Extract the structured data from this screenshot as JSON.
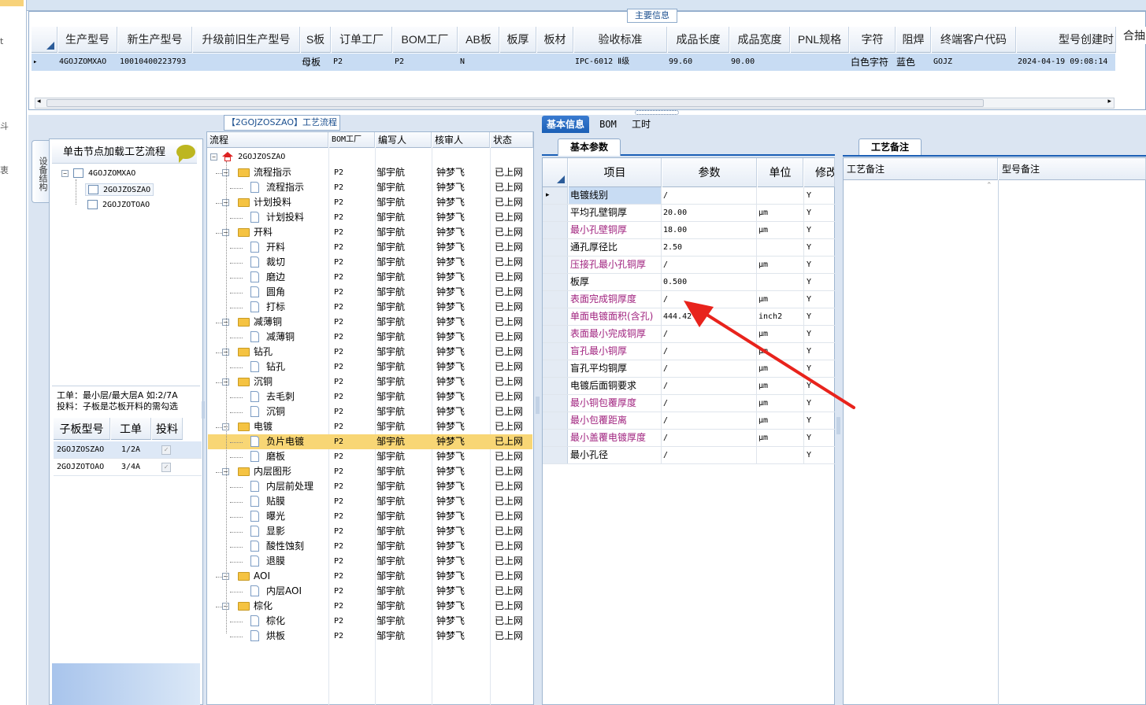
{
  "left_strip": {
    "glyphs": [
      "t",
      "斗",
      "衷"
    ]
  },
  "main_info": {
    "legend": "主要信息",
    "columns": [
      "生产型号",
      "新生产型号",
      "升级前旧生产型号",
      "S板",
      "订单工厂",
      "BOM工厂",
      "AB板",
      "板厚",
      "板材",
      "验收标准",
      "成品长度",
      "成品宽度",
      "PNL规格",
      "字符",
      "阻焊",
      "终端客户代码",
      "型号创建时",
      "合抽"
    ],
    "row": {
      "marker": "▸",
      "model": "4GOJZOMXAO",
      "new_model": "10010400223793",
      "old_model": "",
      "s_board": "母板",
      "order_factory": "P2",
      "bom_factory": "P2",
      "ab_board": "N",
      "thickness": "",
      "material": "",
      "standard": "IPC-6012 Ⅱ级",
      "length": "99.60",
      "width": "90.00",
      "pnl": "",
      "char": "白色字符",
      "mask": "蓝色",
      "customer": "GOJZ",
      "created": "2024-04-19 09:08:14",
      "merge": ""
    }
  },
  "left_panel": {
    "side_tab": "设备结构",
    "title": "单击节点加载工艺流程",
    "tree": [
      "4GOJZOMXAO",
      "2GOJZOSZAO",
      "2GOJZOTOAO"
    ],
    "note_line1": "工单：最小层/最大层A 如:2/7A",
    "note_line2": "投料：子板是芯板开料的需勾选",
    "sub_columns": [
      "子板型号",
      "工单",
      "投料"
    ],
    "sub_rows": [
      {
        "model": "2GOJZOSZAO",
        "order": "1/2A"
      },
      {
        "model": "2GOJZOTOAO",
        "order": "3/4A"
      }
    ]
  },
  "process": {
    "title": "【2GOJZOSZAO】工艺流程",
    "columns": [
      "流程",
      "BOM工厂",
      "编写人",
      "核审人",
      "状态"
    ],
    "root": "2GOJZOSZAO",
    "rows": [
      {
        "name": "流程指示",
        "type": "folder",
        "f": "P2",
        "w": "邹宇航",
        "r": "钟梦飞",
        "s": "已上网"
      },
      {
        "name": "流程指示",
        "type": "doc",
        "f": "P2",
        "w": "邹宇航",
        "r": "钟梦飞",
        "s": "已上网"
      },
      {
        "name": "计划投料",
        "type": "folder",
        "f": "P2",
        "w": "邹宇航",
        "r": "钟梦飞",
        "s": "已上网"
      },
      {
        "name": "计划投料",
        "type": "doc",
        "f": "P2",
        "w": "邹宇航",
        "r": "钟梦飞",
        "s": "已上网"
      },
      {
        "name": "开料",
        "type": "folder",
        "f": "P2",
        "w": "邹宇航",
        "r": "钟梦飞",
        "s": "已上网"
      },
      {
        "name": "开料",
        "type": "doc",
        "f": "P2",
        "w": "邹宇航",
        "r": "钟梦飞",
        "s": "已上网"
      },
      {
        "name": "裁切",
        "type": "doc",
        "f": "P2",
        "w": "邹宇航",
        "r": "钟梦飞",
        "s": "已上网"
      },
      {
        "name": "磨边",
        "type": "doc",
        "f": "P2",
        "w": "邹宇航",
        "r": "钟梦飞",
        "s": "已上网"
      },
      {
        "name": "圆角",
        "type": "doc",
        "f": "P2",
        "w": "邹宇航",
        "r": "钟梦飞",
        "s": "已上网"
      },
      {
        "name": "打标",
        "type": "doc",
        "f": "P2",
        "w": "邹宇航",
        "r": "钟梦飞",
        "s": "已上网"
      },
      {
        "name": "减薄铜",
        "type": "folder",
        "f": "P2",
        "w": "邹宇航",
        "r": "钟梦飞",
        "s": "已上网"
      },
      {
        "name": "减薄铜",
        "type": "doc",
        "f": "P2",
        "w": "邹宇航",
        "r": "钟梦飞",
        "s": "已上网"
      },
      {
        "name": "钻孔",
        "type": "folder",
        "f": "P2",
        "w": "邹宇航",
        "r": "钟梦飞",
        "s": "已上网"
      },
      {
        "name": "钻孔",
        "type": "doc",
        "f": "P2",
        "w": "邹宇航",
        "r": "钟梦飞",
        "s": "已上网"
      },
      {
        "name": "沉铜",
        "type": "folder",
        "f": "P2",
        "w": "邹宇航",
        "r": "钟梦飞",
        "s": "已上网"
      },
      {
        "name": "去毛刺",
        "type": "doc",
        "f": "P2",
        "w": "邹宇航",
        "r": "钟梦飞",
        "s": "已上网"
      },
      {
        "name": "沉铜",
        "type": "doc",
        "f": "P2",
        "w": "邹宇航",
        "r": "钟梦飞",
        "s": "已上网"
      },
      {
        "name": "电镀",
        "type": "folder",
        "f": "P2",
        "w": "邹宇航",
        "r": "钟梦飞",
        "s": "已上网"
      },
      {
        "name": "负片电镀",
        "type": "doc",
        "f": "P2",
        "w": "邹宇航",
        "r": "钟梦飞",
        "s": "已上网",
        "selected": true
      },
      {
        "name": "磨板",
        "type": "doc",
        "f": "P2",
        "w": "邹宇航",
        "r": "钟梦飞",
        "s": "已上网"
      },
      {
        "name": "内层图形",
        "type": "folder",
        "f": "P2",
        "w": "邹宇航",
        "r": "钟梦飞",
        "s": "已上网"
      },
      {
        "name": "内层前处理",
        "type": "doc",
        "f": "P2",
        "w": "邹宇航",
        "r": "钟梦飞",
        "s": "已上网"
      },
      {
        "name": "贴膜",
        "type": "doc",
        "f": "P2",
        "w": "邹宇航",
        "r": "钟梦飞",
        "s": "已上网"
      },
      {
        "name": "曝光",
        "type": "doc",
        "f": "P2",
        "w": "邹宇航",
        "r": "钟梦飞",
        "s": "已上网"
      },
      {
        "name": "显影",
        "type": "doc",
        "f": "P2",
        "w": "邹宇航",
        "r": "钟梦飞",
        "s": "已上网"
      },
      {
        "name": "酸性蚀刻",
        "type": "doc",
        "f": "P2",
        "w": "邹宇航",
        "r": "钟梦飞",
        "s": "已上网"
      },
      {
        "name": "退膜",
        "type": "doc",
        "f": "P2",
        "w": "邹宇航",
        "r": "钟梦飞",
        "s": "已上网"
      },
      {
        "name": "AOI",
        "type": "folder",
        "f": "P2",
        "w": "邹宇航",
        "r": "钟梦飞",
        "s": "已上网"
      },
      {
        "name": "内层AOI",
        "type": "doc",
        "f": "P2",
        "w": "邹宇航",
        "r": "钟梦飞",
        "s": "已上网"
      },
      {
        "name": "棕化",
        "type": "folder",
        "f": "P2",
        "w": "邹宇航",
        "r": "钟梦飞",
        "s": "已上网"
      },
      {
        "name": "棕化",
        "type": "doc",
        "f": "P2",
        "w": "邹宇航",
        "r": "钟梦飞",
        "s": "已上网"
      },
      {
        "name": "烘板",
        "type": "doc",
        "f": "P2",
        "w": "邹宇航",
        "r": "钟梦飞",
        "s": "已上网"
      }
    ]
  },
  "right_tabs": [
    "基本信息",
    "BOM",
    "工时"
  ],
  "basic_params": {
    "subtab": "基本参数",
    "columns": [
      "项目",
      "参数",
      "单位",
      "修改"
    ],
    "rows": [
      {
        "item": "电镀线别",
        "param": "/",
        "unit": "",
        "mod": "Y",
        "purple": false,
        "current": true
      },
      {
        "item": "平均孔壁铜厚",
        "param": "20.00",
        "unit": "μm",
        "mod": "Y",
        "purple": false
      },
      {
        "item": "最小孔壁铜厚",
        "param": "18.00",
        "unit": "μm",
        "mod": "Y",
        "purple": true
      },
      {
        "item": "通孔厚径比",
        "param": "2.50",
        "unit": "",
        "mod": "Y",
        "purple": false
      },
      {
        "item": "压接孔最小孔铜厚",
        "param": "/",
        "unit": "μm",
        "mod": "Y",
        "purple": true
      },
      {
        "item": "板厚",
        "param": "0.500",
        "unit": "",
        "mod": "Y",
        "purple": false
      },
      {
        "item": "表面完成铜厚度",
        "param": "/",
        "unit": "μm",
        "mod": "Y",
        "purple": true
      },
      {
        "item": "单面电镀面积(含孔)",
        "param": "444.42",
        "unit": "inch2",
        "mod": "Y",
        "purple": true
      },
      {
        "item": "表面最小完成铜厚",
        "param": "/",
        "unit": "μm",
        "mod": "Y",
        "purple": true
      },
      {
        "item": "盲孔最小铜厚",
        "param": "/",
        "unit": "μm",
        "mod": "Y",
        "purple": true
      },
      {
        "item": "盲孔平均铜厚",
        "param": "/",
        "unit": "μm",
        "mod": "Y",
        "purple": false
      },
      {
        "item": "电镀后面铜要求",
        "param": "/",
        "unit": "μm",
        "mod": "Y",
        "purple": false
      },
      {
        "item": "最小铜包覆厚度",
        "param": "/",
        "unit": "μm",
        "mod": "Y",
        "purple": true
      },
      {
        "item": "最小包覆距离",
        "param": "/",
        "unit": "μm",
        "mod": "Y",
        "purple": true
      },
      {
        "item": "最小盖覆电镀厚度",
        "param": "/",
        "unit": "μm",
        "mod": "Y",
        "purple": true
      },
      {
        "item": "最小孔径",
        "param": "/",
        "unit": "",
        "mod": "Y",
        "purple": false
      }
    ]
  },
  "process_notes": {
    "tab": "工艺备注",
    "columns": [
      "工艺备注",
      "型号备注"
    ]
  },
  "colors": {
    "accent": "#1b5fb6",
    "selection": "#f8d675",
    "purple_label": "#a0237f",
    "arrow": "#e8231c"
  }
}
